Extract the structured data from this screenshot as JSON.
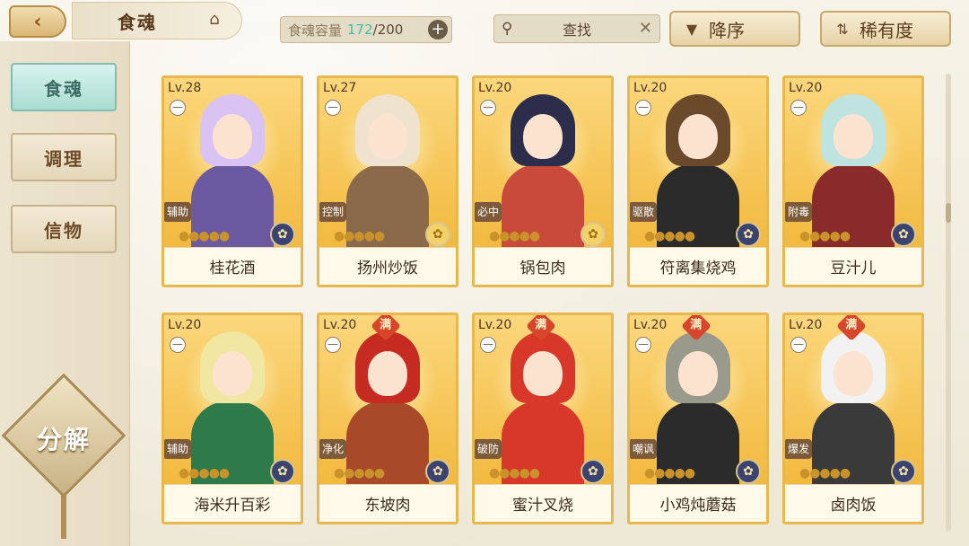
{
  "header": {
    "title": "食魂",
    "capacity_label": "食魂容量",
    "capacity_current": "172",
    "capacity_max": "/200",
    "search_label": "查找",
    "sort_order_label": "降序",
    "sort_rarity_label": "稀有度"
  },
  "sidebar": {
    "items": [
      {
        "label": "食魂",
        "active": true
      },
      {
        "label": "调理",
        "active": false
      },
      {
        "label": "信物",
        "active": false
      }
    ],
    "decompose_label": "分解"
  },
  "cards": [
    {
      "level": "Lv.28",
      "role": "辅助",
      "name": "桂花酒",
      "full": false,
      "stars": "●●●●●"
    },
    {
      "level": "Lv.27",
      "role": "控制",
      "name": "扬州炒饭",
      "full": false,
      "stars": "●●●●●"
    },
    {
      "level": "Lv.20",
      "role": "必中",
      "name": "锅包肉",
      "full": false,
      "stars": "●●●●●"
    },
    {
      "level": "Lv.20",
      "role": "驱散",
      "name": "符离集烧鸡",
      "full": false,
      "stars": "●●●●●"
    },
    {
      "level": "Lv.20",
      "role": "附毒",
      "name": "豆汁儿",
      "full": false,
      "stars": "●●●●●"
    },
    {
      "level": "Lv.20",
      "role": "辅助",
      "name": "海米升百彩",
      "full": false,
      "stars": "●●●●●"
    },
    {
      "level": "Lv.20",
      "role": "净化",
      "name": "东坡肉",
      "full": true,
      "full_label": "满",
      "stars": "●●●●●"
    },
    {
      "level": "Lv.20",
      "role": "破防",
      "name": "蜜汁叉烧",
      "full": true,
      "full_label": "满",
      "stars": "●●●●●"
    },
    {
      "level": "Lv.20",
      "role": "嘲讽",
      "name": "小鸡炖蘑菇",
      "full": true,
      "full_label": "满",
      "stars": "●●●●●"
    },
    {
      "level": "Lv.20",
      "role": "爆发",
      "name": "卤肉饭",
      "full": true,
      "full_label": "满",
      "stars": "●●●●●"
    }
  ],
  "colors": {
    "accent_teal": "#3ec0a6",
    "card_border": "#e6b84e",
    "full_badge": "#d7452b"
  }
}
